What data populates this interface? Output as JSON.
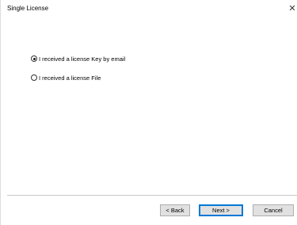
{
  "window": {
    "title": "Single License",
    "close_glyph": "✕"
  },
  "options": [
    {
      "label": "I received a license Key by email",
      "checked": true
    },
    {
      "label": "I received a license File",
      "checked": false
    }
  ],
  "buttons": {
    "back_label": "< Back",
    "next_label": "Next >",
    "cancel_label": "Cancel"
  }
}
